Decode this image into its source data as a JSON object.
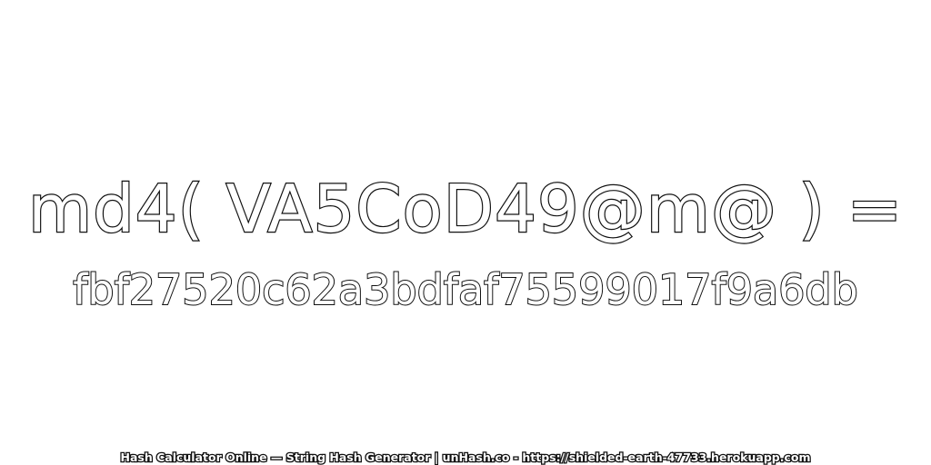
{
  "expression": "md4( VA5CoD49@m@ ) =",
  "hash_value": "fbf27520c62a3bdfaf75599017f9a6db",
  "footer": "Hash Calculator Online — String Hash Generator | unHash.co - https://shielded-earth-47733.herokuapp.com",
  "colors": {
    "background": "#ffffff",
    "text_fill": "#ffffff",
    "text_outline": "#111111"
  }
}
